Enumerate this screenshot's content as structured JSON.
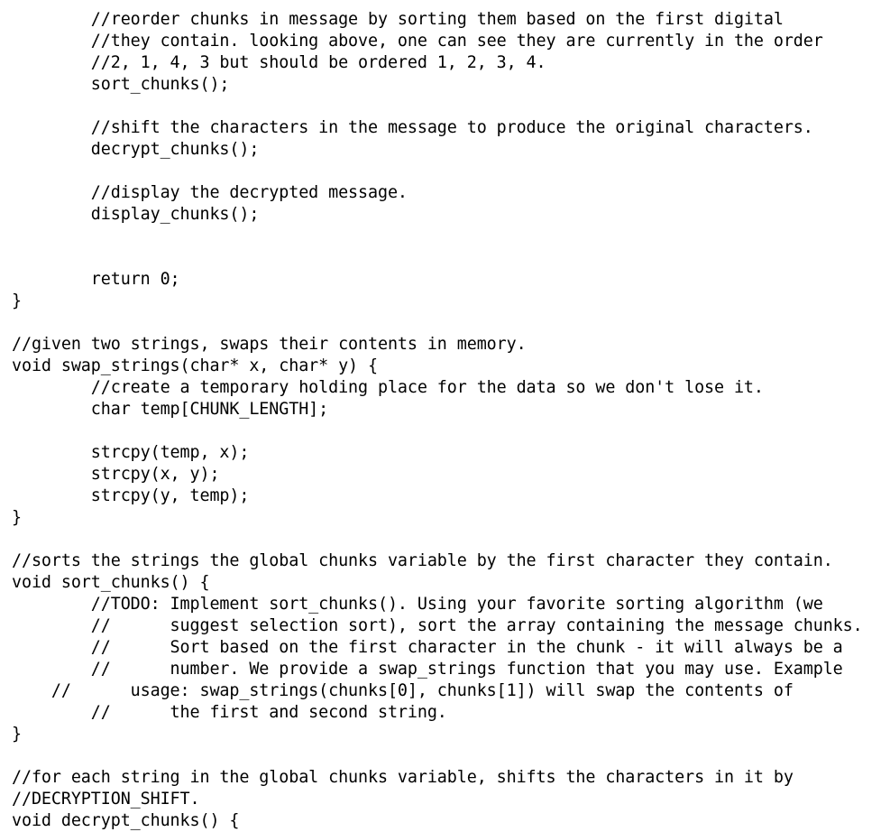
{
  "document": {
    "lines": [
      "        //reorder chunks in message by sorting them based on the first digital",
      "        //they contain. looking above, one can see they are currently in the order",
      "        //2, 1, 4, 3 but should be ordered 1, 2, 3, 4.",
      "        sort_chunks();",
      "",
      "        //shift the characters in the message to produce the original characters.",
      "        decrypt_chunks();",
      "",
      "        //display the decrypted message.",
      "        display_chunks();",
      "",
      "",
      "        return 0;",
      "}",
      "",
      "//given two strings, swaps their contents in memory.",
      "void swap_strings(char* x, char* y) {",
      "        //create a temporary holding place for the data so we don't lose it.",
      "        char temp[CHUNK_LENGTH];",
      "",
      "        strcpy(temp, x);",
      "        strcpy(x, y);",
      "        strcpy(y, temp);",
      "}",
      "",
      "//sorts the strings the global chunks variable by the first character they contain.",
      "void sort_chunks() {",
      "        //TODO: Implement sort_chunks(). Using your favorite sorting algorithm (we",
      "        //      suggest selection sort), sort the array containing the message chunks.",
      "        //      Sort based on the first character in the chunk - it will always be a",
      "        //      number. We provide a swap_strings function that you may use. Example",
      "    //      usage: swap_strings(chunks[0], chunks[1]) will swap the contents of",
      "        //      the first and second string.",
      "}",
      "",
      "//for each string in the global chunks variable, shifts the characters in it by",
      "//DECRYPTION_SHIFT.",
      "void decrypt_chunks() {"
    ]
  }
}
